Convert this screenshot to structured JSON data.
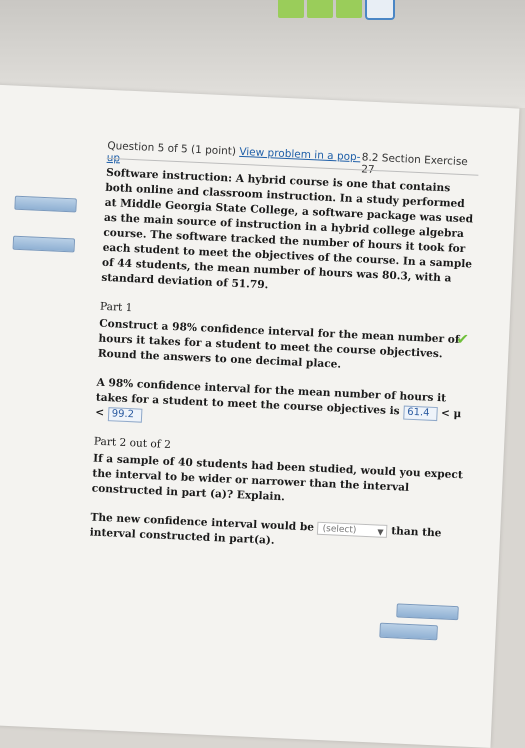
{
  "header": {
    "question_label": "Question 5 of 5 (1 point)",
    "popup_link": "View problem in a pop-up",
    "section": "8.2 Section Exercise 27"
  },
  "problem": {
    "text": "Software instruction: A hybrid course is one that contains both online and classroom instruction. In a study performed at Middle Georgia State College, a software package was used as the main source of instruction in a hybrid college algebra course. The software tracked the number of hours it took for each student to meet the objectives of the course. In a sample of 44 students, the mean number of hours was 80.3, with a standard deviation of 51.79."
  },
  "part1": {
    "title": "Part 1",
    "instruction": "Construct a 98% confidence interval for the mean number of hours it takes for a student to meet the course objectives. Round the answers to one decimal place.",
    "ci_prefix": "A 98% confidence interval for the mean number of hours it takes for a student to meet the course objectives is",
    "lower": "61.4",
    "mid": "< μ <",
    "upper": "99.2"
  },
  "part2": {
    "title": "Part 2 out of 2",
    "question": "If a sample of 40 students had been studied, would you expect the interval to be wider or narrower than the interval constructed in part (a)? Explain.",
    "sentence_start": "The new confidence interval would be",
    "select_value": "(select)",
    "sentence_end": "than the interval constructed in part(a)."
  }
}
